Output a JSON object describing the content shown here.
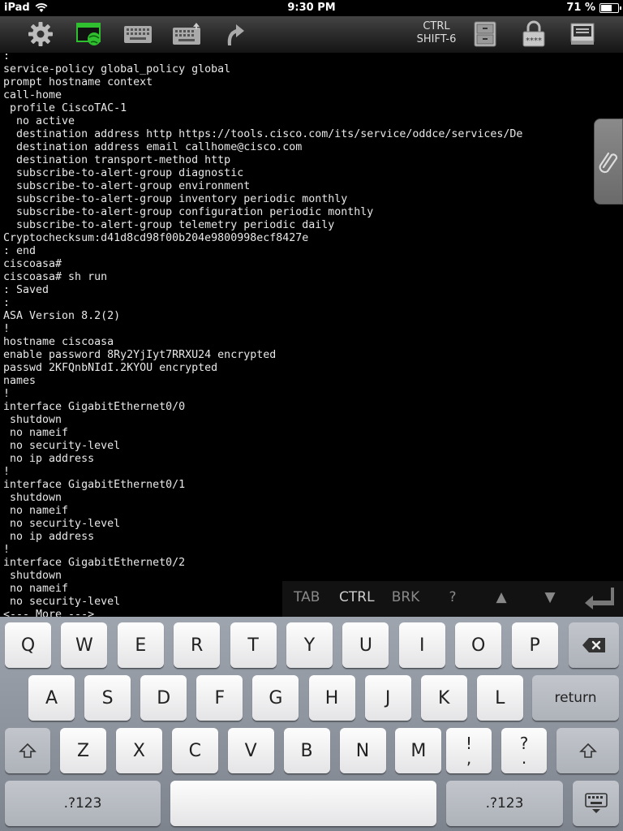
{
  "status_bar": {
    "device": "iPad",
    "time": "9:30 PM",
    "battery": "71 %",
    "battery_level": 0.71
  },
  "toolbar": {
    "icons": [
      "gear-icon",
      "browser-globe-icon",
      "keyboard-icon",
      "keyboard-hide-icon",
      "return-arrow-icon",
      "file-cabinet-icon",
      "lock-password-icon",
      "screen-inbox-icon"
    ],
    "ctrl_line1": "CTRL",
    "ctrl_line2": "SHIFT-6",
    "password_mask": "****"
  },
  "terminal": {
    "text": ":\nservice-policy global_policy global\nprompt hostname context\ncall-home\n profile CiscoTAC-1\n  no active\n  destination address http https://tools.cisco.com/its/service/oddce/services/De\n  destination address email callhome@cisco.com\n  destination transport-method http\n  subscribe-to-alert-group diagnostic\n  subscribe-to-alert-group environment\n  subscribe-to-alert-group inventory periodic monthly\n  subscribe-to-alert-group configuration periodic monthly\n  subscribe-to-alert-group telemetry periodic daily\nCryptochecksum:d41d8cd98f00b204e9800998ecf8427e\n: end\nciscoasa#\nciscoasa# sh run\n: Saved\n:\nASA Version 8.2(2)\n!\nhostname ciscoasa\nenable password 8Ry2YjIyt7RRXU24 encrypted\npasswd 2KFQnbNIdI.2KYOU encrypted\nnames\n!\ninterface GigabitEthernet0/0\n shutdown\n no nameif\n no security-level\n no ip address\n!\ninterface GigabitEthernet0/1\n shutdown\n no nameif\n no security-level\n no ip address\n!\ninterface GigabitEthernet0/2\n shutdown\n no nameif\n no security-level\n<--- More --->"
  },
  "key_bar": {
    "tab": "TAB",
    "ctrl": "CTRL",
    "brk": "BRK",
    "question": "?",
    "up": "▲",
    "down": "▼"
  },
  "keyboard": {
    "row1": [
      "Q",
      "W",
      "E",
      "R",
      "T",
      "Y",
      "U",
      "I",
      "O",
      "P"
    ],
    "row2": [
      "A",
      "S",
      "D",
      "F",
      "G",
      "H",
      "J",
      "K",
      "L"
    ],
    "row3": [
      "Z",
      "X",
      "C",
      "V",
      "B",
      "N",
      "M"
    ],
    "excl_top": "!",
    "excl_bottom": ",",
    "ques_top": "?",
    "ques_bottom": ".",
    "return": "return",
    "numbers_left": ".?123",
    "numbers_right": ".?123"
  }
}
